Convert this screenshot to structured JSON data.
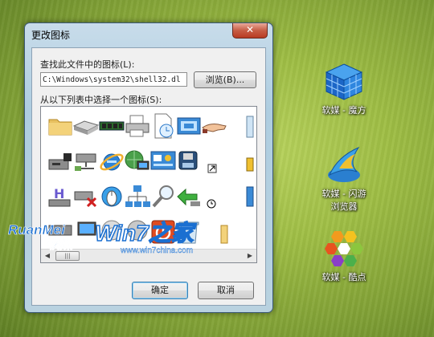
{
  "desktop_icons": [
    {
      "label": "软媒 - 魔方",
      "icon": "rubiks-cube-icon"
    },
    {
      "label": "软媒 - 闪游\n浏览器",
      "icon": "browser-bird-icon"
    },
    {
      "label": "软媒 - 酷点",
      "icon": "hexagon-cluster-icon"
    }
  ],
  "dialog": {
    "title": "更改图标",
    "close_glyph": "✕",
    "find_label": "查找此文件中的图标(L):",
    "path_value": "C:\\Windows\\system32\\shell32.dl",
    "browse_label": "浏览(B)...",
    "select_label": "从以下列表中选择一个图标(S):",
    "ok_label": "确定",
    "cancel_label": "取消",
    "icons": [
      "folder-icon",
      "scanner-icon",
      "memory-chip-icon",
      "printer-icon",
      "document-clock-icon",
      "display-settings-icon",
      "hand-icon",
      "bin-icon",
      "drive-icon",
      "network-drive-icon",
      "internet-explorer-icon",
      "network-globe-icon",
      "control-panel-icon",
      "disk-icon",
      "shortcut-arrow-icon",
      "padlock-icon",
      "help-drive-icon",
      "network-disconnect-icon",
      "mouse-globe-icon",
      "network-tree-icon",
      "magnifier-icon",
      "green-arrow-icon",
      "clock-small-icon",
      "window-icon",
      "drive-small-icon",
      "computer-icon",
      "cd-icon",
      "cdrom-icon",
      "power-icon",
      "recycle-bin-icon",
      "folder-partial-icon"
    ]
  },
  "watermark": {
    "brand_latin": "RuanMei",
    "brand_cn": "软媒",
    "site_big": "Win7之家",
    "site_url": "www.win7china.com"
  },
  "colors": {
    "title_close": "#c75d45",
    "dialog_frame": "#aecde0",
    "watermark_blue": "#1a6fd1"
  }
}
